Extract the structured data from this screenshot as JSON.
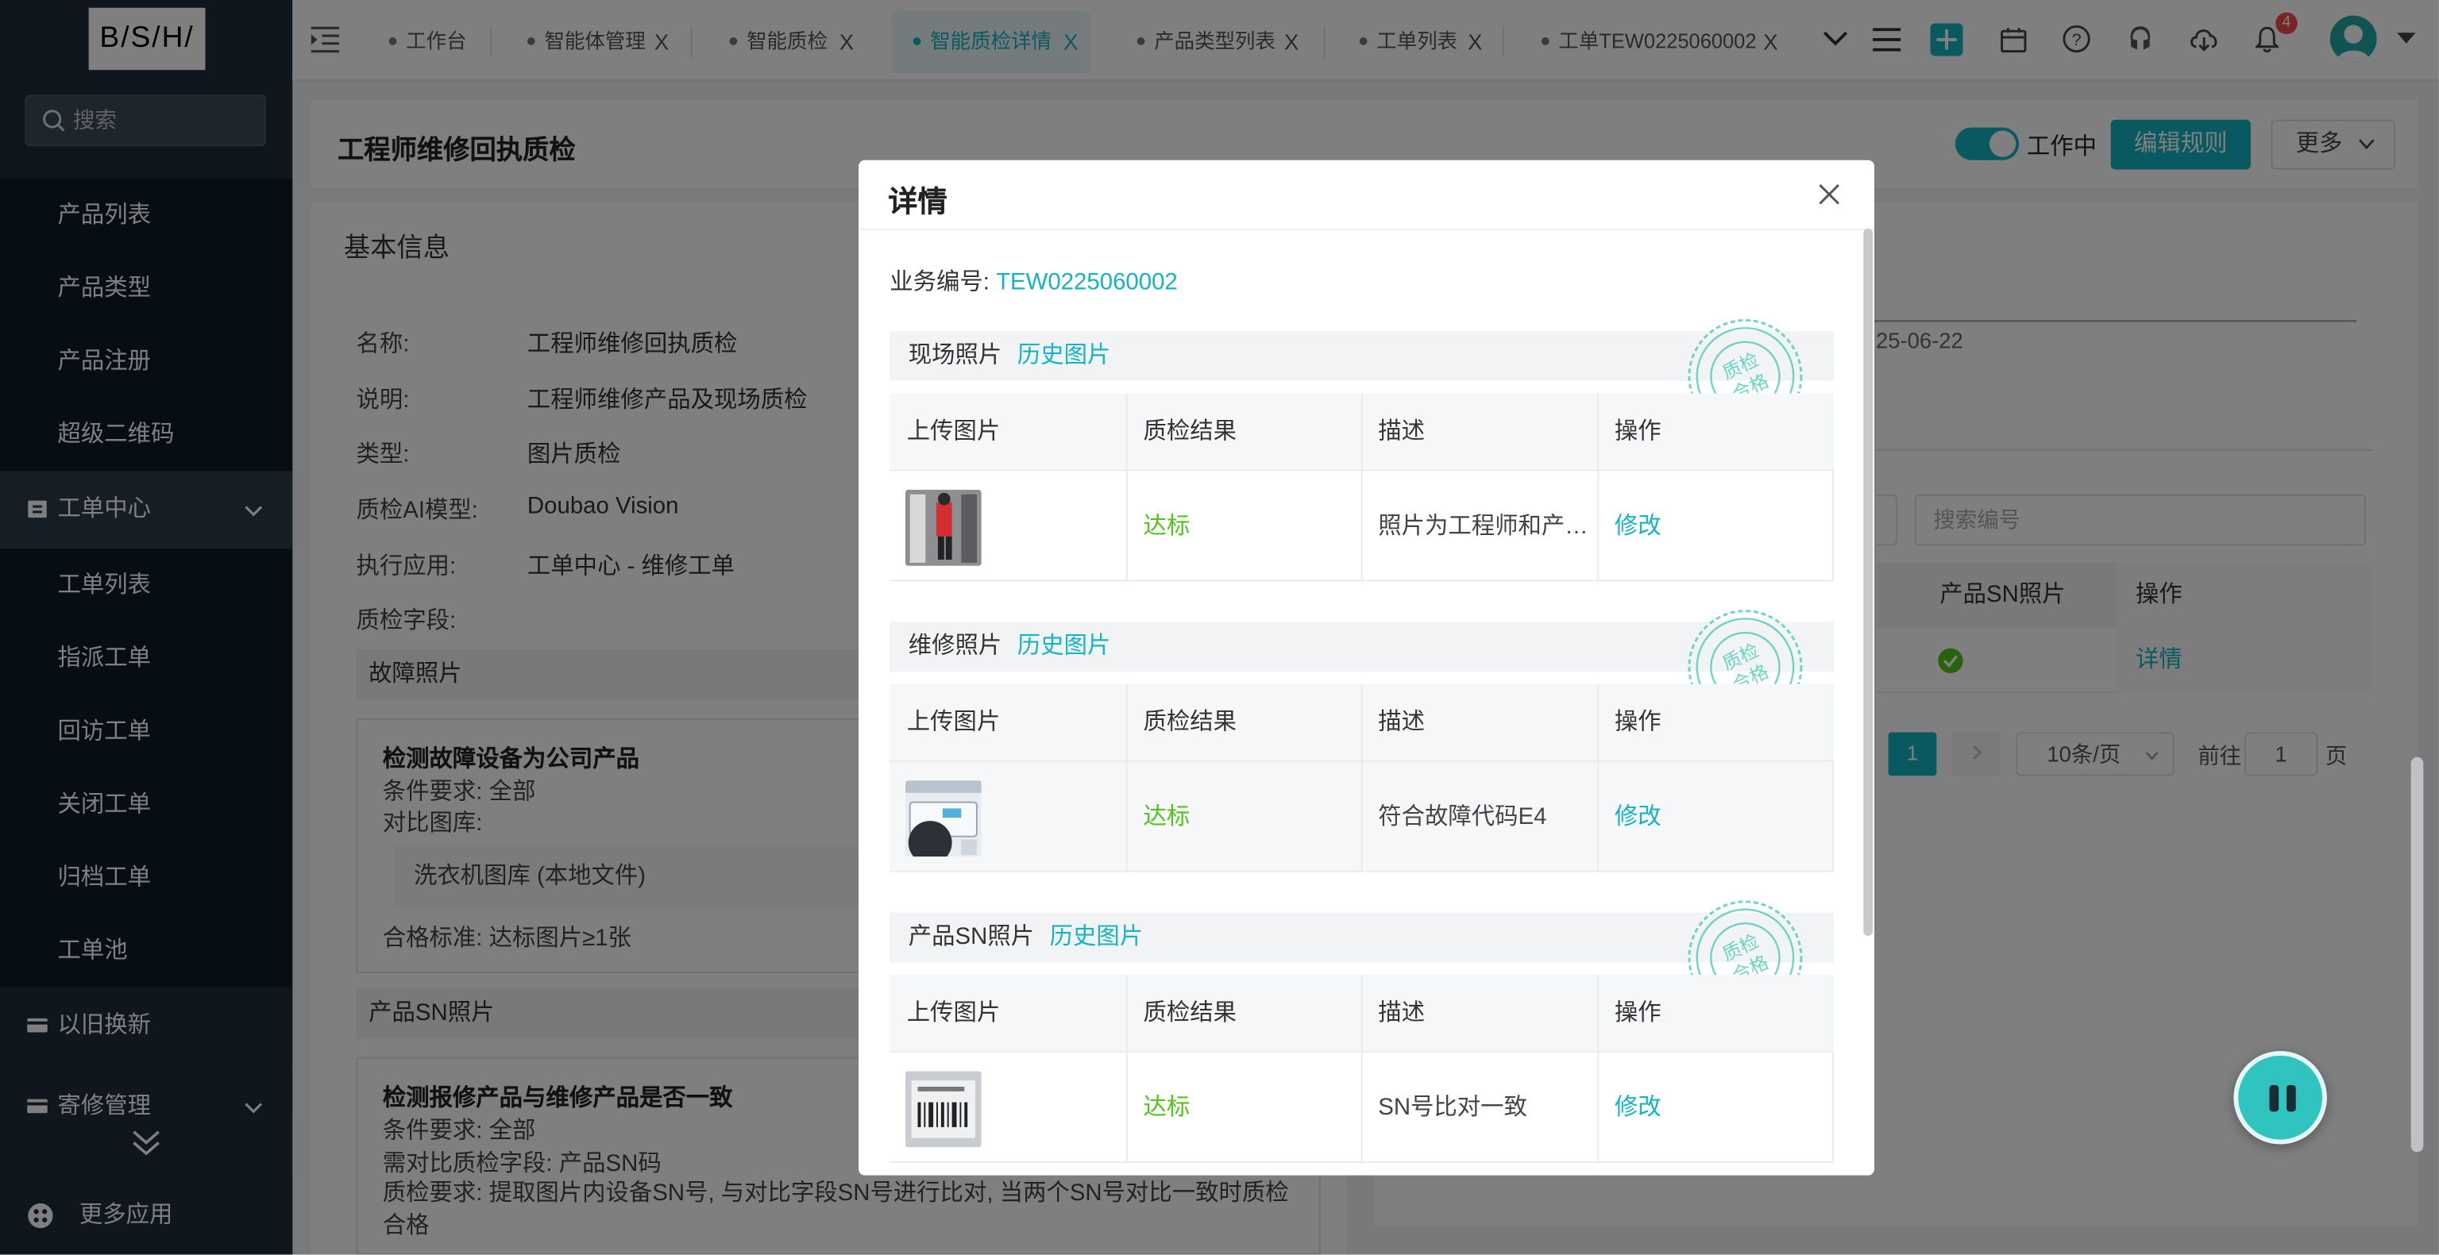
{
  "sidebar": {
    "logo": "B/S/H/",
    "search_placeholder": "搜索",
    "items_top": [
      "产品列表",
      "产品类型",
      "产品注册",
      "超级二维码"
    ],
    "group_workorder": "工单中心",
    "items_workorder": [
      "工单列表",
      "指派工单",
      "回访工单",
      "关闭工单",
      "归档工单",
      "工单池"
    ],
    "group_tradein": "以旧换新",
    "group_parts": "寄修管理",
    "more_apps": "更多应用"
  },
  "tabs": [
    {
      "label": "工作台",
      "closable": false
    },
    {
      "label": "智能体管理",
      "closable": true
    },
    {
      "label": "智能质检",
      "closable": true
    },
    {
      "label": "智能质检详情",
      "closable": true,
      "active": true
    },
    {
      "label": "产品类型列表",
      "closable": true
    },
    {
      "label": "工单列表",
      "closable": true
    },
    {
      "label": "工单TEW0225060002",
      "closable": true
    }
  ],
  "topbar": {
    "notification_count": "4",
    "close_glyph": "X"
  },
  "page": {
    "title": "工程师维修回执质检",
    "status_label": "工作中",
    "edit_rule": "编辑规则",
    "more": "更多",
    "basic_info": "基本信息",
    "fields": [
      {
        "label": "名称:",
        "value": "工程师维修回执质检"
      },
      {
        "label": "说明:",
        "value": "工程师维修产品及现场质检"
      },
      {
        "label": "类型:",
        "value": "图片质检"
      },
      {
        "label": "质检AI模型:",
        "value": "Doubao Vision"
      },
      {
        "label": "执行应用:",
        "value": "工单中心 - 维修工单"
      },
      {
        "label": "质检字段:",
        "value": ""
      }
    ],
    "fault_section": {
      "title": "故障照片",
      "rule_title": "检测故障设备为公司产品",
      "condition": "条件要求:  全部",
      "compare_lib": "对比图库:",
      "gallery": "洗衣机图库 (本地文件)",
      "standard": "合格标准:  达标图片≥1张"
    },
    "sn_section": {
      "title": "产品SN照片",
      "rule_title": "检测报修产品与维修产品是否一致",
      "condition": "条件要求:  全部",
      "compare_field": "需对比质检字段:  产品SN码",
      "requirement": "质检要求:  提取图片内设备SN号, 与对比字段SN号进行比对, 当两个SN号对比一致时质检合格"
    },
    "right": {
      "date_fragment": "25-06-22",
      "search_placeholder": "搜索编号",
      "col_sn": "产品SN照片",
      "col_op": "操作",
      "row_op": "详情",
      "page_current": "1",
      "page_size": "10条/页",
      "goto_prefix": "前往",
      "goto_value": "1",
      "goto_suffix": "页"
    }
  },
  "modal": {
    "title": "详情",
    "biz_label": "业务编号:",
    "biz_no": "TEW0225060002",
    "stamp_text": [
      "质检",
      "合格"
    ],
    "headers": [
      "上传图片",
      "质检结果",
      "描述",
      "操作"
    ],
    "sections": [
      {
        "title": "现场照片",
        "history": "历史图片",
        "result": "达标",
        "desc": "照片为工程师和产…",
        "op": "修改"
      },
      {
        "title": "维修照片",
        "history": "历史图片",
        "result": "达标",
        "desc": "符合故障代码E4",
        "op": "修改"
      },
      {
        "title": "产品SN照片",
        "history": "历史图片",
        "result": "达标",
        "desc": "SN号比对一致",
        "op": "修改"
      }
    ]
  },
  "colors": {
    "accent": "#13b5c1",
    "sidebar": "#1f2d3d",
    "success": "#52c41a"
  }
}
